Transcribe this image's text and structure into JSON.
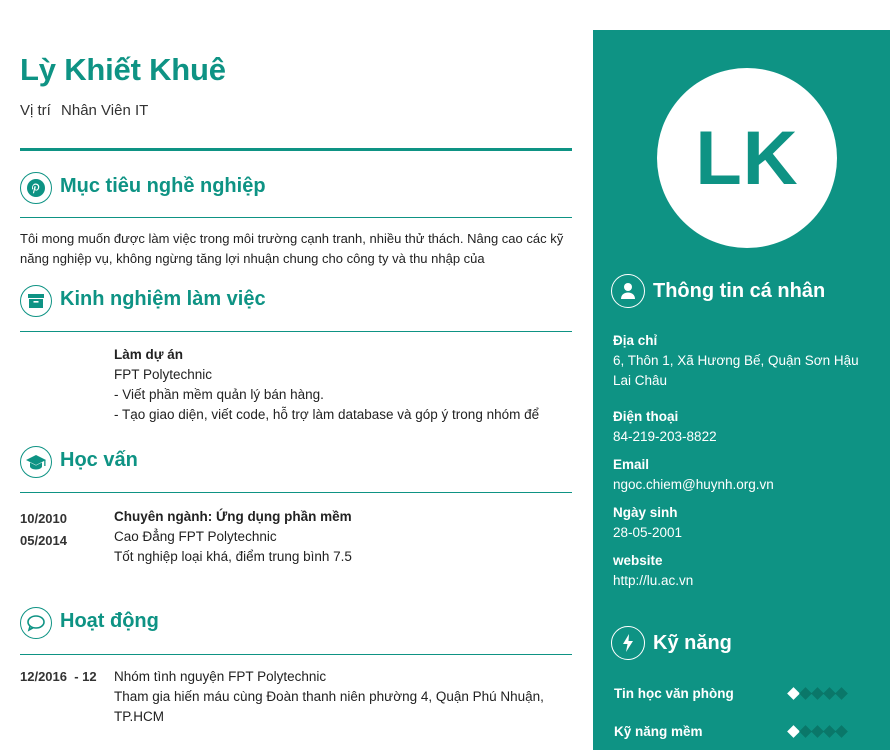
{
  "header": {
    "name": "Lỳ Khiết Khuê",
    "position_label": "Vị trí",
    "position_value": "Nhân Viên IT"
  },
  "sections": {
    "objective": {
      "title": "Mục tiêu nghề nghiệp",
      "icon": "pinterest-icon",
      "text": "Tôi mong muốn được làm việc trong môi trường cạnh tranh, nhiều thử thách. Nâng cao các kỹ năng nghiệp vụ, không ngừng tăng lợi nhuận chung cho công ty và thu nhập của"
    },
    "experience": {
      "title": "Kinh nghiệm làm việc",
      "icon": "archive-icon",
      "role": "Làm dự án",
      "company": "FPT Polytechnic",
      "lines": [
        "- Viết phần mềm quản lý bán hàng.",
        "- Tạo giao diện, viết code, hỗ trợ làm database và góp ý trong nhóm để"
      ]
    },
    "education": {
      "title": "Học vấn",
      "icon": "graduation-cap-icon",
      "date_start": "10/2010",
      "date_end": "05/2014",
      "major": "Chuyên ngành: Ứng dụng phần mềm",
      "school": "Cao Đẳng FPT Polytechnic",
      "note": "Tốt nghiệp loại khá, điểm trung bình 7.5"
    },
    "activities": {
      "title": "Hoạt động",
      "icon": "chat-bubble-icon",
      "date": "12/2016  - 12",
      "org": "Nhóm tình nguyện FPT Polytechnic",
      "desc": "Tham gia hiến máu cùng Đoàn thanh niên phường 4, Quận Phú Nhuận, TP.HCM"
    }
  },
  "sidebar": {
    "initials": "LK",
    "personal": {
      "title": "Thông tin cá nhân",
      "icon": "user-icon",
      "address_label": "Địa chỉ",
      "address_line1": "6, Thôn 1, Xã Hương Bế, Quận Sơn Hậu",
      "address_line2": "Lai Châu",
      "phone_label": "Điện thoại",
      "phone": "84-219-203-8822",
      "email_label": "Email",
      "email": "ngoc.chiem@huynh.org.vn",
      "dob_label": "Ngày sinh",
      "dob": "28-05-2001",
      "website_label": "website",
      "website": "http://lu.ac.vn"
    },
    "skills": {
      "title": "Kỹ năng",
      "icon": "lightning-icon",
      "items": [
        {
          "label": "Tin học văn phòng",
          "level": 1,
          "max": 5
        },
        {
          "label": "Kỹ năng mềm",
          "level": 1,
          "max": 5
        }
      ]
    }
  },
  "colors": {
    "accent": "#0e9384",
    "text": "#222222"
  }
}
